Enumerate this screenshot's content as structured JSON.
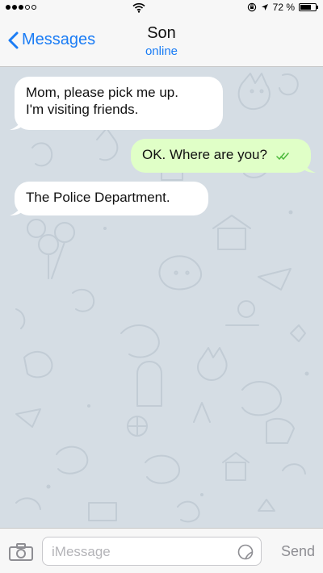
{
  "status_bar": {
    "battery_text": "72 %",
    "battery_level": 0.72
  },
  "header": {
    "back_label": "Messages",
    "contact_name": "Son",
    "contact_status": "online"
  },
  "messages": [
    {
      "direction": "incoming",
      "text_lines": [
        "Mom, please pick me up.",
        "I'm visiting friends."
      ]
    },
    {
      "direction": "outgoing",
      "text": "OK. Where are you?",
      "status": "read"
    },
    {
      "direction": "incoming",
      "text": "The Police Department."
    }
  ],
  "composer": {
    "placeholder": "iMessage",
    "send_label": "Send"
  },
  "colors": {
    "accent": "#1a7cf5",
    "outgoing_bubble": "#e0ffc7",
    "incoming_bubble": "#ffffff",
    "wallpaper": "#d5dde4",
    "read_checks": "#4cb93c"
  }
}
